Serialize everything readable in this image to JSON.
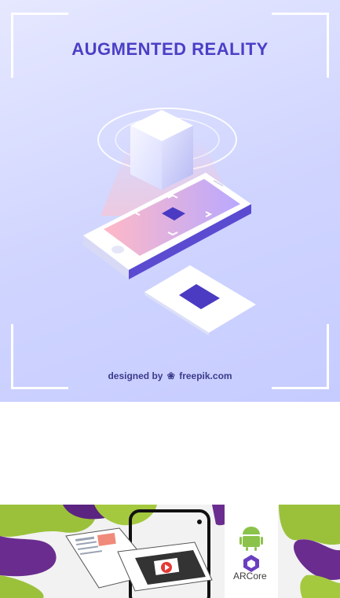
{
  "hero": {
    "title": "AUGMENTED REALITY",
    "credit_prefix": "designed by",
    "credit_brand": "freepik.com",
    "colors": {
      "background": "#d4d8ff",
      "title": "#4b3fc6",
      "accent": "#5146c8"
    }
  },
  "banner": {
    "brand_label": "ARCore",
    "icons": [
      "android-icon",
      "arcore-logo-icon",
      "play-icon"
    ],
    "colors": {
      "lime": "#9bc13b",
      "purple": "#6a2d8f"
    }
  }
}
